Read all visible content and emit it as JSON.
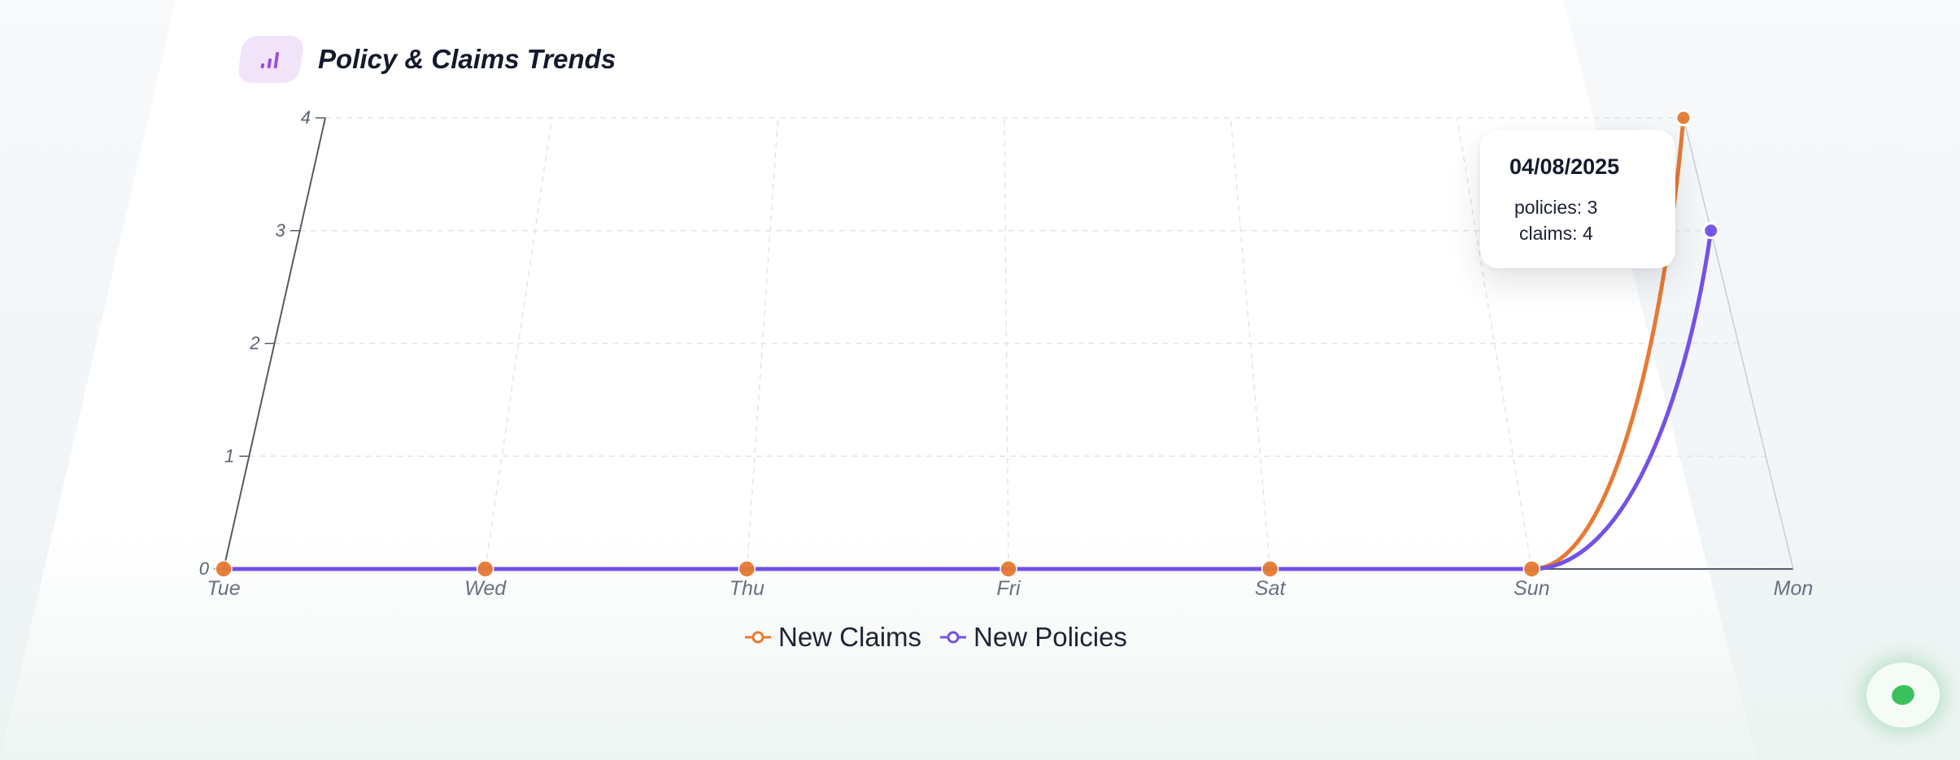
{
  "header": {
    "title": "Policy & Claims Trends",
    "icon": "bar-chart-icon",
    "icon_color": "#9b4fd6"
  },
  "chart_data": {
    "type": "line",
    "categories": [
      "Tue",
      "Wed",
      "Thu",
      "Fri",
      "Sat",
      "Sun",
      "Mon"
    ],
    "series": [
      {
        "name": "New Claims",
        "color": "#e67a32",
        "values": [
          0,
          0,
          0,
          0,
          0,
          0,
          4
        ]
      },
      {
        "name": "New Policies",
        "color": "#7352e6",
        "values": [
          0,
          0,
          0,
          0,
          0,
          0,
          3
        ]
      }
    ],
    "ylim": [
      0,
      4
    ],
    "y_ticks": [
      "0",
      "1",
      "2",
      "3",
      "4"
    ],
    "grid": true,
    "legend_position": "bottom"
  },
  "tooltip": {
    "date": "04/08/2025",
    "policies": "policies: 3",
    "claims": "claims: 4"
  },
  "fab": {
    "icon": "status-dot-icon",
    "color": "#3cc05e"
  }
}
